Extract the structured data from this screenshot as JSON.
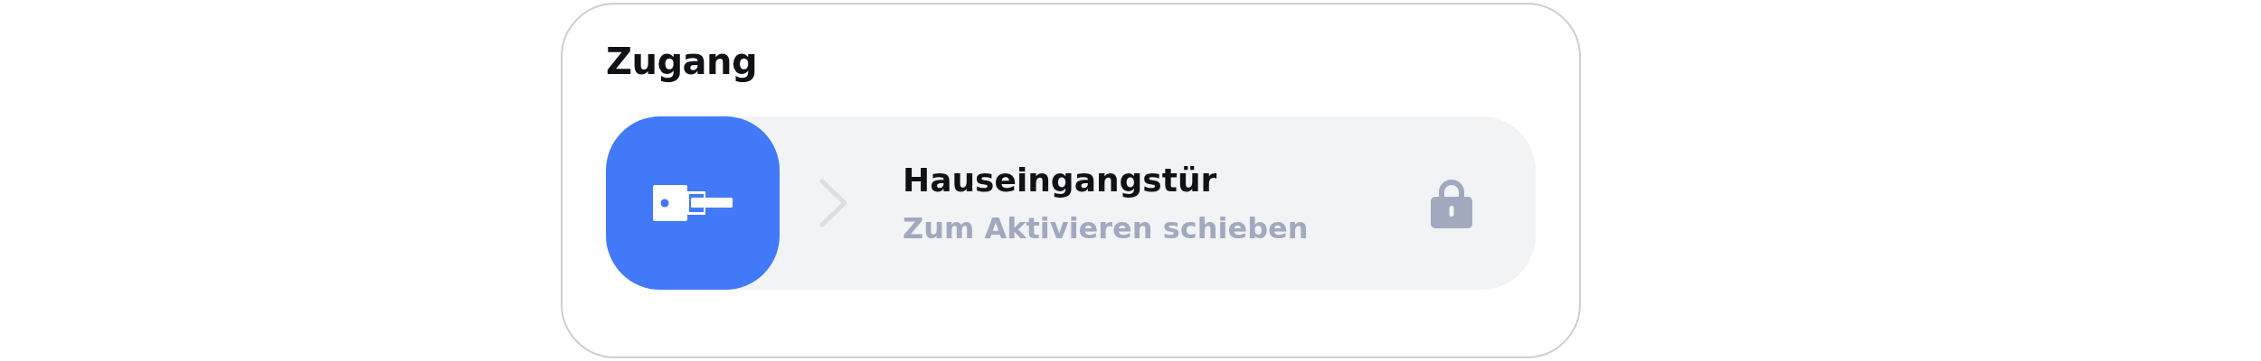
{
  "section": {
    "title": "Zugang"
  },
  "slider": {
    "title": "Hauseingangstür",
    "hint": "Zum Aktivieren schieben",
    "level": 0,
    "locked": true
  }
}
